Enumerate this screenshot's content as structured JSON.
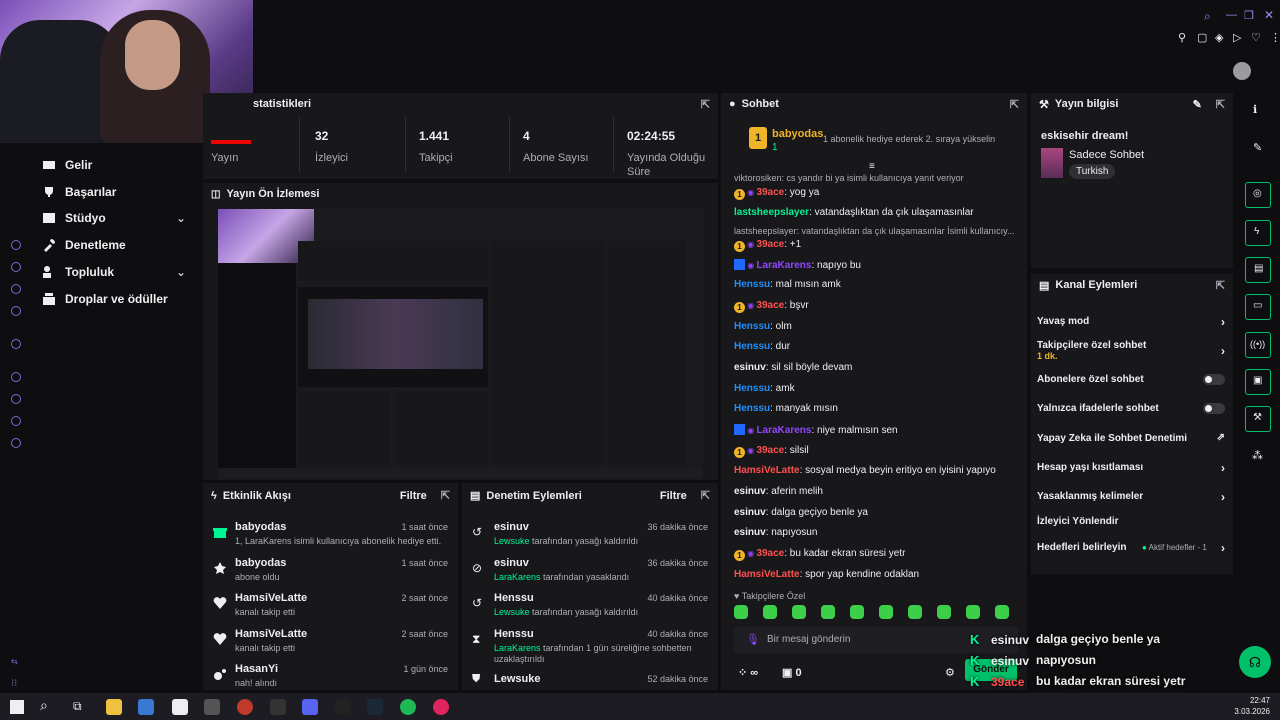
{
  "stats": {
    "title": "statistikleri",
    "items": [
      {
        "value": "",
        "label": "Yayın"
      },
      {
        "value": "32",
        "label": "İzleyici"
      },
      {
        "value": "1.441",
        "label": "Takipçi"
      },
      {
        "value": "4",
        "label": "Abone Sayısı"
      },
      {
        "value": "02:24:55",
        "label": "Yayında Olduğu Süre"
      }
    ]
  },
  "nav": {
    "items": [
      {
        "label": "Gelir"
      },
      {
        "label": "Başarılar"
      },
      {
        "label": "Stüdyo"
      },
      {
        "label": "Denetleme"
      },
      {
        "label": "Topluluk"
      },
      {
        "label": "Droplar ve ödüller"
      }
    ]
  },
  "preview": {
    "title": "Yayın Ön İzlemesi"
  },
  "activity": {
    "title": "Etkinlik Akışı",
    "filter": "Filtre",
    "items": [
      {
        "name": "babyodas",
        "time": "1 saat önce",
        "desc": "1, LaraKarens isimli kullanıcıya abonelik hediye etti.",
        "icon": "gift-icon"
      },
      {
        "name": "babyodas",
        "time": "1 saat önce",
        "desc": "abone oldu",
        "icon": "star-icon"
      },
      {
        "name": "HamsiVeLatte",
        "time": "2 saat önce",
        "desc": "kanalı takip etti",
        "icon": "heart-icon"
      },
      {
        "name": "HamsiVeLatte",
        "time": "2 saat önce",
        "desc": "kanalı takip etti",
        "icon": "heart-icon"
      },
      {
        "name": "HasanYi",
        "time": "1 gün önce",
        "desc": "nah! alındı",
        "icon": "channel-points-icon"
      }
    ]
  },
  "moderation": {
    "title": "Denetim Eylemleri",
    "filter": "Filtre",
    "items": [
      {
        "name": "esinuv",
        "time": "36 dakika önce",
        "actor": "Lewsuke",
        "desc": " tarafından yasağı kaldırıldı",
        "icon": "undo-icon"
      },
      {
        "name": "esinuv",
        "time": "36 dakika önce",
        "actor": "LaraKarens",
        "desc": " tarafından yasaklandı",
        "icon": "ban-icon"
      },
      {
        "name": "Henssu",
        "time": "40 dakika önce",
        "actor": "Lewsuke",
        "desc": " tarafından yasağı kaldırıldı",
        "icon": "undo-icon"
      },
      {
        "name": "Henssu",
        "time": "40 dakika önce",
        "actor": "LaraKarens",
        "desc": " tarafından 1 gün süreliğine sohbetten uzaklaştırıldı",
        "icon": "hourglass-icon"
      },
      {
        "name": "Lewsuke",
        "time": "52 dakika önce",
        "actor": "",
        "desc": "",
        "icon": "shield-icon"
      }
    ]
  },
  "chat": {
    "title": "Sohbet",
    "pinned": {
      "user": "babyodas",
      "count": "1",
      "text": "1 abonelik hediye ederek 2. sıraya yükselin"
    },
    "lines": [
      {
        "reply": "viktorosiken: cs yandır bi ya isimli kullanıcıya yanıt veriyor"
      },
      {
        "badge": "1",
        "user": "39ace",
        "color": "#ff4f4f",
        "text": ": yog ya"
      },
      {
        "user": "lastsheepslayer",
        "color": "#00f593",
        "text": ": vatandaşlıktan da çık ulaşamasınlar"
      },
      {
        "reply": "lastsheepslayer: vatandaşlıktan da çık ulaşamasınlar İsimli kullanıcıy..."
      },
      {
        "badge": "1",
        "user": "39ace",
        "color": "#ff4f4f",
        "text": ": +1"
      },
      {
        "badge": "x",
        "user": "LaraKarens",
        "color": "#9147ff",
        "text": ": napıyo bu"
      },
      {
        "user": "Henssu",
        "color": "#1e90ff",
        "text": ": mal mısın amk"
      },
      {
        "badge": "1",
        "user": "39ace",
        "color": "#ff4f4f",
        "text": ": bşvr"
      },
      {
        "user": "Henssu",
        "color": "#1e90ff",
        "text": ": olm"
      },
      {
        "user": "Henssu",
        "color": "#1e90ff",
        "text": ": dur"
      },
      {
        "user": "esinuv",
        "color": "#efeff1",
        "text": ": sil sil böyle devam"
      },
      {
        "user": "Henssu",
        "color": "#1e90ff",
        "text": ": amk"
      },
      {
        "user": "Henssu",
        "color": "#1e90ff",
        "text": ": manyak mısın"
      },
      {
        "badge": "x",
        "user": "LaraKarens",
        "color": "#9147ff",
        "text": ": niye malmısın sen"
      },
      {
        "badge": "1",
        "user": "39ace",
        "color": "#ff4f4f",
        "text": ": silsil"
      },
      {
        "user": "HamsiVeLatte",
        "color": "#ff4f4f",
        "text": ": sosyal medya beyin eritiyo en iyisini yapıyo"
      },
      {
        "user": "esinuv",
        "color": "#efeff1",
        "text": ": aferin melih"
      },
      {
        "user": "esinuv",
        "color": "#efeff1",
        "text": ": dalga geçiyo benle ya"
      },
      {
        "user": "esinuv",
        "color": "#efeff1",
        "text": ": napıyosun"
      },
      {
        "badge": "1",
        "user": "39ace",
        "color": "#ff4f4f",
        "text": ": bu kadar ekran süresi yetr"
      },
      {
        "user": "HamsiVeLatte",
        "color": "#ff4f4f",
        "text": ": spor yap kendine odaklan"
      }
    ],
    "followers_only": "Takipçilere Özel",
    "input_placeholder": "Bir mesaj gönderin",
    "viewers": "∞",
    "points": "0",
    "send": "Gönder"
  },
  "info": {
    "title": "Yayın bilgisi",
    "stream_title": "eskisehir dream!",
    "category": "Sadece Sohbet",
    "tag": "Turkish"
  },
  "actions": {
    "title": "Kanal Eylemleri",
    "items": [
      {
        "label": "Yavaş mod",
        "type": "chevron"
      },
      {
        "label": "Takipçilere özel sohbet",
        "sub": "1 dk.",
        "type": "chevron"
      },
      {
        "label": "Abonelere özel sohbet",
        "type": "toggle"
      },
      {
        "label": "Yalnızca ifadelerle sohbet",
        "type": "toggle"
      },
      {
        "label": "Yapay Zeka ile Sohbet Denetimi",
        "type": "external"
      },
      {
        "label": "Hesap yaşı kısıtlaması",
        "type": "chevron"
      },
      {
        "label": "Yasaklanmış kelimeler",
        "type": "chevron"
      },
      {
        "label": "İzleyici Yönlendir",
        "type": "none"
      },
      {
        "label": "Hedefleri belirleyin",
        "extra": "Aktif hedefler - 1",
        "type": "chevron"
      }
    ]
  },
  "overlay": [
    {
      "user": "esinuv",
      "color": "#efeff1",
      "text": "dalga geçiyo benle ya"
    },
    {
      "user": "esinuv",
      "color": "#efeff1",
      "text": "napıyosun"
    },
    {
      "user": "39ace",
      "color": "#ff4f4f",
      "text": "bu kadar ekran süresi yetr"
    },
    {
      "user": "HamsiVeLatte",
      "color": "#ff4f4f",
      "text": "spor yap kendine odaklan"
    }
  ],
  "taskbar": {
    "time": "22:47",
    "date": "3.03.2026"
  },
  "colors": {
    "accent": "#00f593",
    "panel": "#18181b",
    "bg": "#0e0e10"
  }
}
